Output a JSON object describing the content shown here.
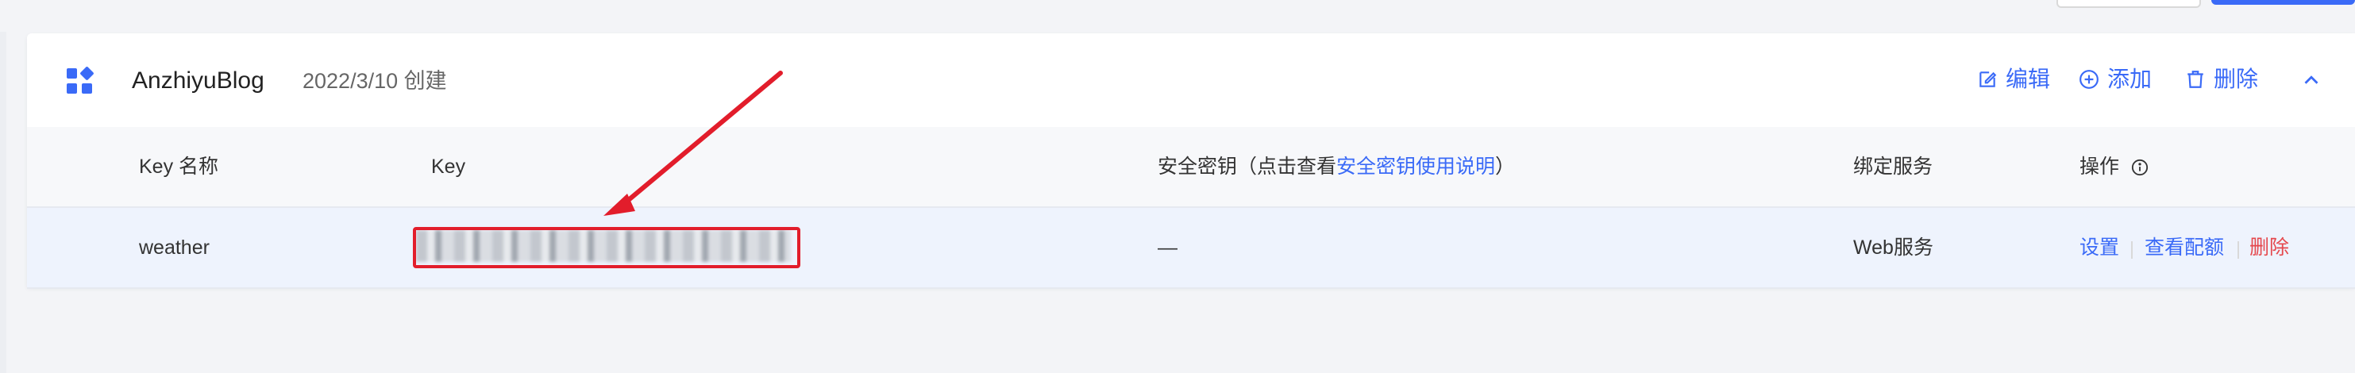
{
  "card": {
    "app_name": "AnzhiyuBlog",
    "created": "2022/3/10 创建",
    "actions": {
      "edit": "编辑",
      "add": "添加",
      "delete": "删除"
    }
  },
  "table": {
    "headers": {
      "key_name": "Key 名称",
      "key": "Key",
      "secret_prefix": "安全密钥（点击查看",
      "secret_link": "安全密钥使用说明",
      "secret_suffix": "）",
      "service": "绑定服务",
      "ops": "操作"
    },
    "rows": [
      {
        "key_name": "weather",
        "secret": "—",
        "service": "Web服务",
        "actions": {
          "settings": "设置",
          "quota": "查看配额",
          "delete": "删除"
        }
      }
    ]
  },
  "colors": {
    "accent": "#3a6af7",
    "danger": "#e5484d",
    "annotation": "#e21d2b"
  },
  "icons": {
    "app": "grid-app-icon",
    "edit": "edit-icon",
    "add": "plus-circle-icon",
    "delete": "trash-icon",
    "collapse": "chevron-up-icon",
    "info": "info-circle-icon"
  }
}
